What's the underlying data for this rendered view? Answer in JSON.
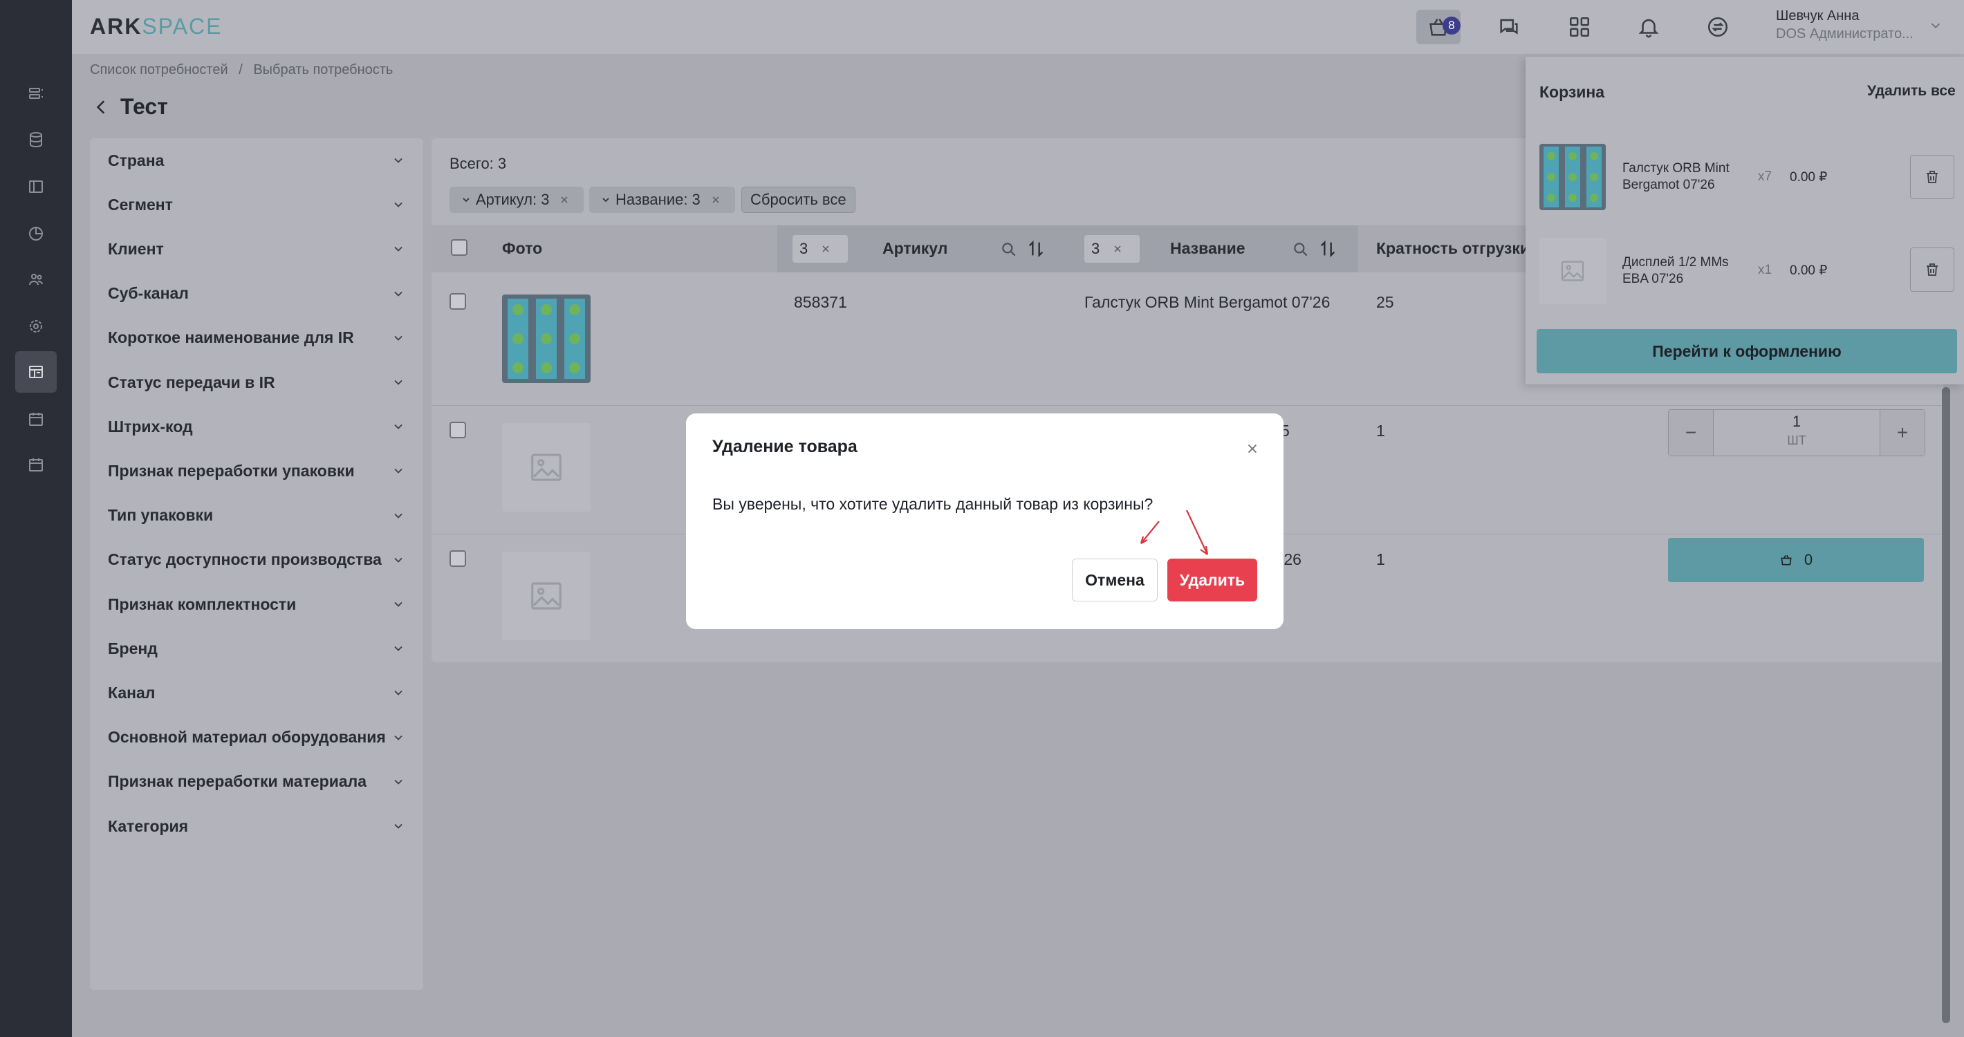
{
  "app": {
    "logo_ark": "ARK",
    "logo_space": "SPACE"
  },
  "header": {
    "cart_count": "8",
    "user_name": "Шевчук Анна",
    "user_role": "DOS Администрато..."
  },
  "breadcrumbs": [
    "Список потребностей",
    "/",
    "Выбрать потребность"
  ],
  "page_title": "Тест",
  "filters": [
    "Страна",
    "Сегмент",
    "Клиент",
    "Суб-канал",
    "Короткое наименование для IR",
    "Статус передачи в IR",
    "Штрих-код",
    "Признак переработки упаковки",
    "Тип упаковки",
    "Статус доступности производства",
    "Признак комплектности",
    "Бренд",
    "Канал",
    "Основной материал оборудования",
    "Признак переработки материала",
    "Категория"
  ],
  "table": {
    "total": "Всего: 3",
    "chips": {
      "article": "Артикул: 3",
      "name": "Название: 3",
      "reset": "Сбросить все"
    },
    "headers": {
      "photo": "Фото",
      "article_count": "3",
      "article": "Артикул",
      "name_count": "3",
      "name": "Название",
      "multiplicity": "Кратность отгрузки"
    },
    "rows": [
      {
        "article": "858371",
        "name": "Галстук ORB Mint Bergamot 07'26",
        "multiplicity": "25"
      },
      {
        "article": "",
        "name": "5",
        "multiplicity": "1"
      },
      {
        "article": "",
        "name": "'26",
        "multiplicity": "1"
      }
    ],
    "qty_value": "1",
    "qty_unit": "ШТ",
    "cart_btn_value": "0"
  },
  "cart": {
    "title": "Корзина",
    "clear_all": "Удалить все",
    "items": [
      {
        "name": "Галстук ORB Mint Bergamot 07'26",
        "qty": "x7",
        "price": "0.00 ₽"
      },
      {
        "name": "Дисплей 1/2 MMs EBA 07'26",
        "qty": "x1",
        "price": "0.00 ₽"
      }
    ],
    "checkout": "Перейти к оформлению"
  },
  "modal": {
    "title": "Удаление товара",
    "text": "Вы уверены, что хотите удалить данный товар из корзины?",
    "cancel": "Отмена",
    "delete": "Удалить"
  },
  "colors": {
    "accent_teal": "#5e9aa3",
    "danger": "#e8404e",
    "badge": "#3c3d8c",
    "rail": "#2b2e37"
  }
}
